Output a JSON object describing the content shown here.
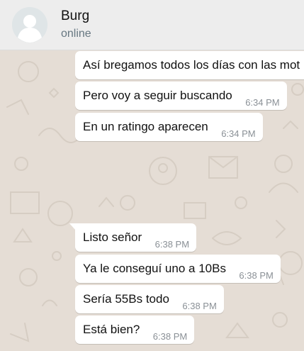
{
  "contact": {
    "name": "Burg",
    "status": "online"
  },
  "messages": [
    {
      "text": "Así bregamos todos los días con las mot",
      "time": ""
    },
    {
      "text": "Pero voy a seguir buscando",
      "time": "6:34 PM"
    },
    {
      "text": "En un ratingo aparecen",
      "time": "6:34 PM"
    },
    {
      "text": "Listo señor",
      "time": "6:38 PM"
    },
    {
      "text": "Ya le conseguí uno a 10Bs",
      "time": "6:38 PM"
    },
    {
      "text": "Sería 55Bs todo",
      "time": "6:38 PM"
    },
    {
      "text": "Está bien?",
      "time": "6:38 PM"
    }
  ],
  "colors": {
    "header_bg": "#ededed",
    "chat_bg": "#e5ddd5",
    "bubble_bg": "#ffffff",
    "time_text": "#8a9096"
  }
}
